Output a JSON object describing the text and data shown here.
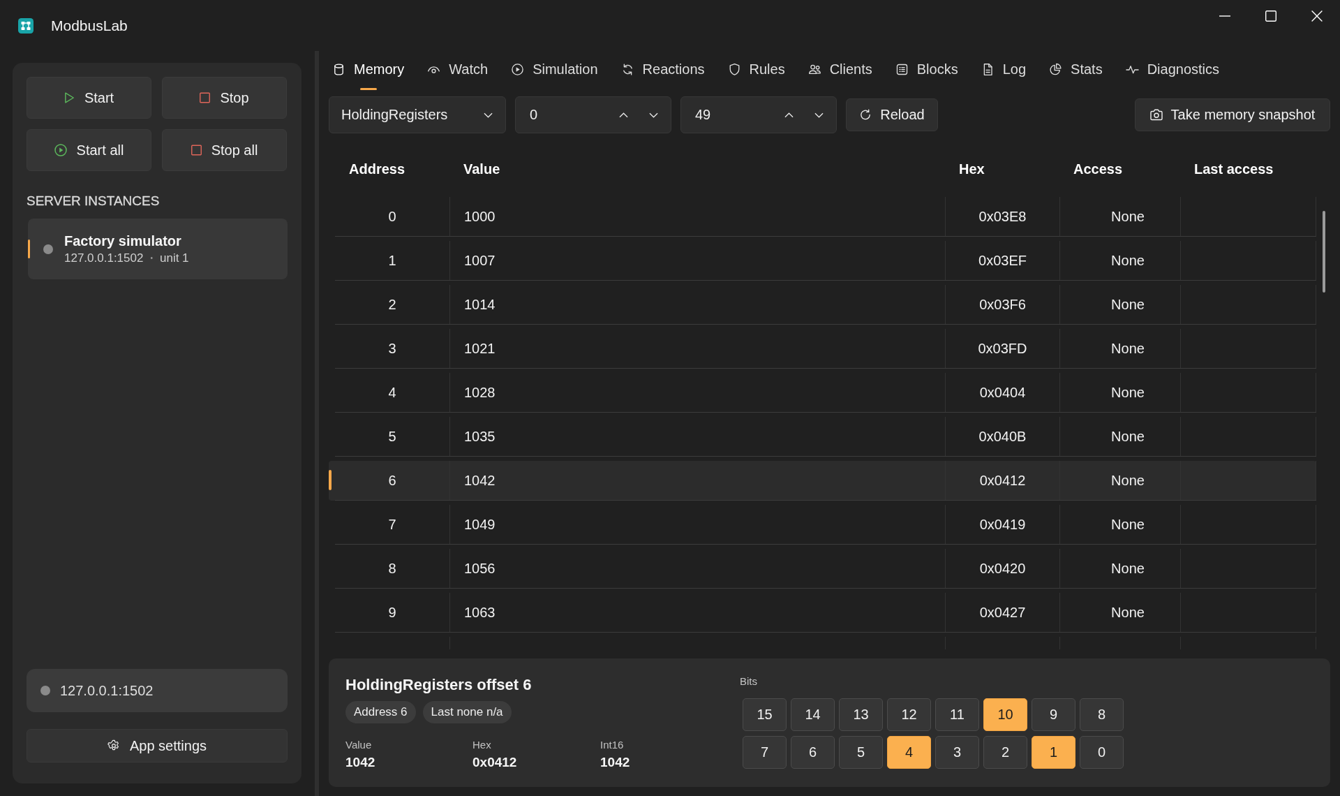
{
  "window": {
    "title": "ModbusLab"
  },
  "sidebar": {
    "actions": [
      {
        "kind": "start",
        "label": "Start"
      },
      {
        "kind": "stop",
        "label": "Stop"
      },
      {
        "kind": "start_all",
        "label": "Start all"
      },
      {
        "kind": "stop_all",
        "label": "Stop all"
      }
    ],
    "section_title": "SERVER INSTANCES",
    "instances": [
      {
        "name": "Factory simulator",
        "endpoint": "127.0.0.1:1502",
        "separator": "•",
        "unit": "unit 1",
        "running": false,
        "selected": true
      }
    ],
    "connection": {
      "endpoint": "127.0.0.1:1502",
      "running": false
    },
    "settings_button": {
      "label": "App settings"
    }
  },
  "tabs": [
    {
      "label": "Memory",
      "selected": true
    },
    {
      "label": "Watch",
      "selected": false
    },
    {
      "label": "Simulation",
      "selected": false
    },
    {
      "label": "Reactions",
      "selected": false
    },
    {
      "label": "Rules",
      "selected": false
    },
    {
      "label": "Clients",
      "selected": false
    },
    {
      "label": "Blocks",
      "selected": false
    },
    {
      "label": "Log",
      "selected": false
    },
    {
      "label": "Stats",
      "selected": false
    },
    {
      "label": "Diagnostics",
      "selected": false
    }
  ],
  "toolbar": {
    "area": {
      "value": "HoldingRegisters"
    },
    "start": {
      "value": "0"
    },
    "end": {
      "value": "49"
    },
    "reload": {
      "label": "Reload"
    },
    "snapshot": {
      "label": "Take memory snapshot"
    }
  },
  "table": {
    "columns": [
      "Address",
      "Value",
      "Hex",
      "Access",
      "Last access"
    ],
    "rows": [
      {
        "address": "0",
        "value": "1000",
        "hex": "0x03E8",
        "access": "None",
        "selected": false
      },
      {
        "address": "1",
        "value": "1007",
        "hex": "0x03EF",
        "access": "None",
        "selected": false
      },
      {
        "address": "2",
        "value": "1014",
        "hex": "0x03F6",
        "access": "None",
        "selected": false
      },
      {
        "address": "3",
        "value": "1021",
        "hex": "0x03FD",
        "access": "None",
        "selected": false
      },
      {
        "address": "4",
        "value": "1028",
        "hex": "0x0404",
        "access": "None",
        "selected": false
      },
      {
        "address": "5",
        "value": "1035",
        "hex": "0x040B",
        "access": "None",
        "selected": false
      },
      {
        "address": "6",
        "value": "1042",
        "hex": "0x0412",
        "access": "None",
        "selected": true
      },
      {
        "address": "7",
        "value": "1049",
        "hex": "0x0419",
        "access": "None",
        "selected": false
      },
      {
        "address": "8",
        "value": "1056",
        "hex": "0x0420",
        "access": "None",
        "selected": false
      },
      {
        "address": "9",
        "value": "1063",
        "hex": "0x0427",
        "access": "None",
        "selected": false
      }
    ]
  },
  "detail": {
    "title": "HoldingRegisters offset 6",
    "tags": [
      "Address 6",
      "Last none n/a"
    ],
    "fields": [
      {
        "label": "Value",
        "value": "1042"
      },
      {
        "label": "Hex",
        "value": "0x0412"
      },
      {
        "label": "Int16",
        "value": "1042"
      }
    ],
    "bits_label": "Bits",
    "bits": [
      {
        "label": "15",
        "on": false
      },
      {
        "label": "14",
        "on": false
      },
      {
        "label": "13",
        "on": false
      },
      {
        "label": "12",
        "on": false
      },
      {
        "label": "11",
        "on": false
      },
      {
        "label": "10",
        "on": true
      },
      {
        "label": "9",
        "on": false
      },
      {
        "label": "8",
        "on": false
      },
      {
        "label": "7",
        "on": false
      },
      {
        "label": "6",
        "on": false
      },
      {
        "label": "5",
        "on": false
      },
      {
        "label": "4",
        "on": true
      },
      {
        "label": "3",
        "on": false
      },
      {
        "label": "2",
        "on": false
      },
      {
        "label": "1",
        "on": true
      },
      {
        "label": "0",
        "on": false
      }
    ]
  }
}
